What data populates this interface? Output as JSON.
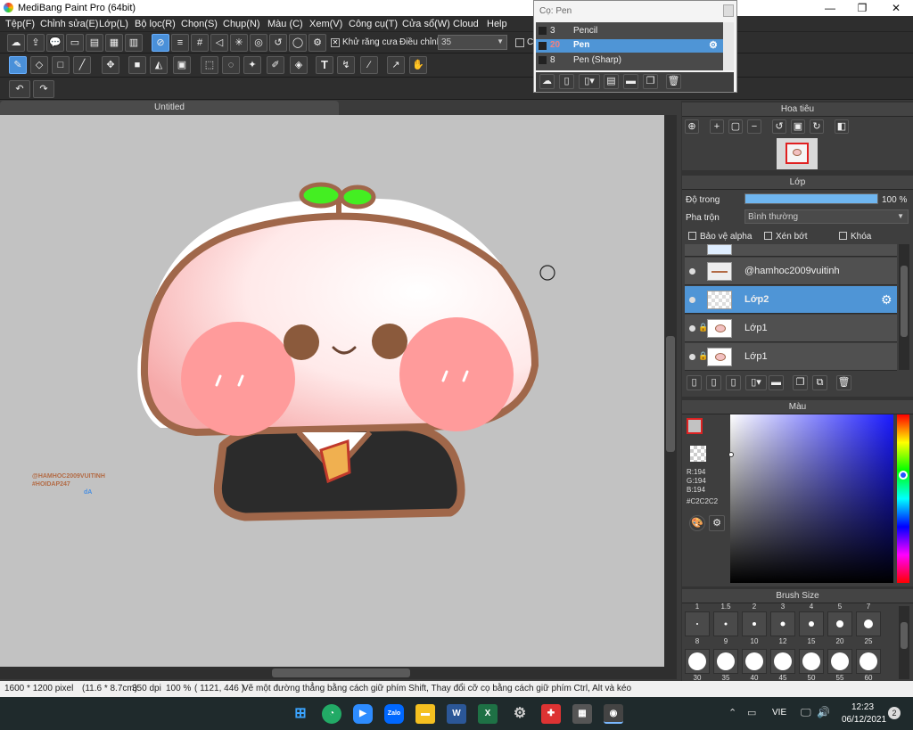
{
  "window": {
    "title": "MediBang Paint Pro (64bit)",
    "minimize": "—",
    "maximize": "❐",
    "close": "✕"
  },
  "menu": [
    "Tệp(F)",
    "Chỉnh sửa(E)",
    "Lớp(L)",
    "Bộ lọc(R)",
    "Chọn(S)",
    "Chụp(N)",
    "Màu (C)",
    "Xem(V)",
    "Công cụ(T)",
    "Cửa sổ(W)",
    "Cloud",
    "Help"
  ],
  "toolbar": {
    "antialias_label": "Khử răng cưa",
    "adjust_label": "Điều chỉnh",
    "adjust_value": "35",
    "cut_text": "Cr"
  },
  "tools_icon_names": [
    "brush-icon",
    "eraser-icon",
    "rectangle-icon",
    "line-icon",
    "move-icon",
    "fill-rect-icon",
    "bucket-icon",
    "gradient-icon",
    "select-rect-icon",
    "lasso-icon",
    "magic-wand-icon",
    "select-pen-icon",
    "select-eraser-icon",
    "text-icon",
    "divide-icon",
    "eyedropper-icon",
    "operation-icon",
    "hand-icon"
  ],
  "document": {
    "tab_title": "Untitled",
    "watermark_line1": "@HAMHOC2009VUITINH",
    "watermark_line2": "#HOIDAP247",
    "watermark_line3": "dA"
  },
  "brush_popup": {
    "title": "Cọ: Pen",
    "items": [
      {
        "size": "3",
        "name": "Pencil"
      },
      {
        "size": "20",
        "name": "Pen"
      },
      {
        "size": "8",
        "name": "Pen (Sharp)"
      }
    ]
  },
  "navigator": {
    "title": "Hoa tiêu"
  },
  "layers": {
    "title": "Lớp",
    "opacity_label": "Độ trong",
    "opacity_value": "100 %",
    "opacity": 1.0,
    "blend_label": "Pha trộn",
    "blend_value": "Bình thường",
    "protect_alpha": "Bảo vệ alpha",
    "clip": "Xén bớt",
    "lock": "Khóa",
    "items": [
      {
        "name": "@hamhoc2009vuitinh"
      },
      {
        "name": "Lớp2"
      },
      {
        "name": "Lớp1"
      },
      {
        "name": "Lớp1"
      }
    ]
  },
  "color": {
    "title": "Màu",
    "r": "R:194",
    "g": "G:194",
    "b": "B:194",
    "hex": "#C2C2C2",
    "current": "#c2c2c2"
  },
  "brush_size": {
    "title": "Brush Size",
    "labels_row1": [
      "1",
      "1.5",
      "2",
      "3",
      "4",
      "5",
      "7"
    ],
    "labels_row2": [
      "8",
      "9",
      "10",
      "12",
      "15",
      "20",
      "25"
    ],
    "labels_row3": [
      "30",
      "35",
      "40",
      "45",
      "50",
      "55",
      "60"
    ]
  },
  "status": {
    "size": "1600 * 1200 pixel",
    "cm": "(11.6 * 8.7cm)",
    "dpi": "350 dpi",
    "zoom": "100 %",
    "coords": "( 1121, 446 )",
    "hint": "Vẽ một đường thẳng bằng cách giữ phím Shift, Thay đổi cỡ cọ bằng cách giữ phím Ctrl, Alt và kéo"
  },
  "taskbar": {
    "lang": "VIE",
    "time": "12:23",
    "date": "06/12/2021",
    "notif": "2",
    "apps": [
      "windows-start-icon",
      "browser-icon",
      "zoom-icon",
      "zalo-icon",
      "file-explorer-icon",
      "word-icon",
      "excel-icon",
      "settings-icon",
      "puzzle-icon",
      "calculator-icon",
      "medibang-icon"
    ]
  }
}
